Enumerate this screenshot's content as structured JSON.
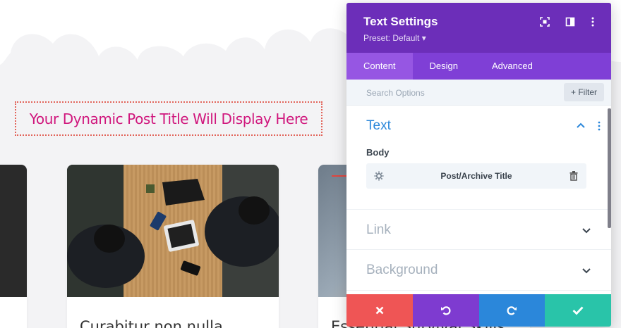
{
  "page": {
    "dynamic_title": "Your Dynamic Post Title Will Display Here",
    "cards": [
      {
        "title": "Curabitur non nulla"
      },
      {
        "title": "Essential Survival Skills"
      }
    ]
  },
  "panel": {
    "title": "Text Settings",
    "preset": "Preset: Default ▾",
    "icons": [
      "focus-icon",
      "split-view-icon",
      "more-vertical-icon"
    ],
    "tabs": [
      {
        "label": "Content",
        "active": true
      },
      {
        "label": "Design",
        "active": false
      },
      {
        "label": "Advanced",
        "active": false
      }
    ],
    "search_placeholder": "Search Options",
    "filter_label": "+ Filter",
    "sections": {
      "text": {
        "title": "Text",
        "body_label": "Body",
        "dynamic_value": "Post/Archive Title"
      },
      "link": {
        "title": "Link"
      },
      "background": {
        "title": "Background"
      }
    }
  },
  "colors": {
    "header": "#6c2eb9",
    "tabs": "#7f3fd6",
    "accent_blue": "#2b87da",
    "title_pink": "#d0177d",
    "cancel": "#ef5555",
    "undo": "#7e3bd0",
    "redo": "#2b87da",
    "save": "#29c4a9"
  }
}
